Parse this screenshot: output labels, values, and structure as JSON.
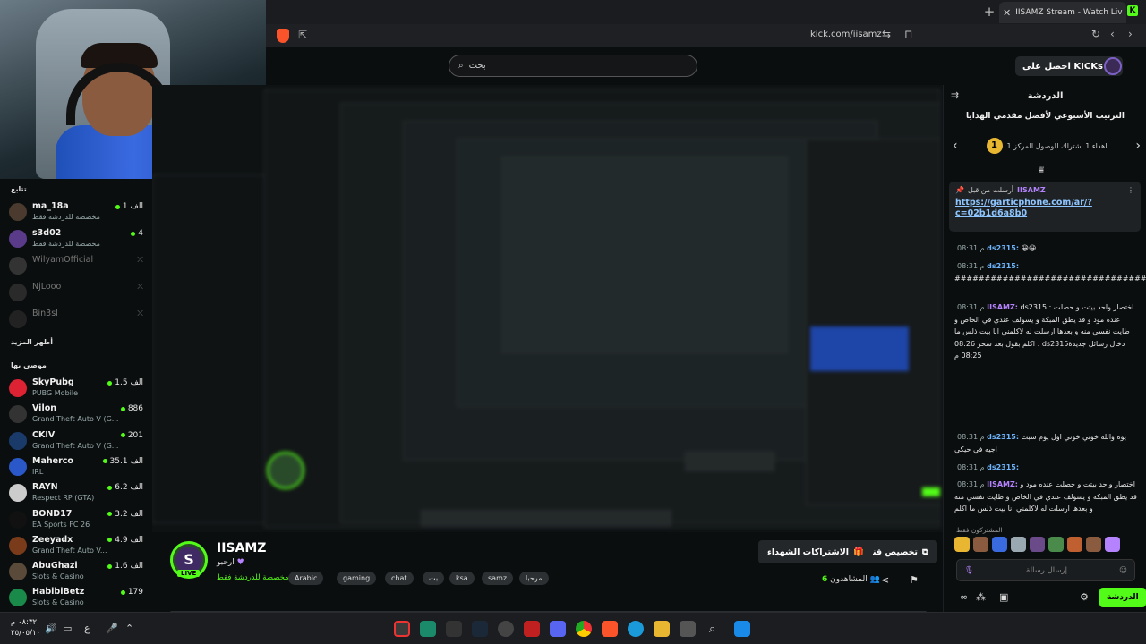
{
  "browser": {
    "tab_title": "IISAMZ Stream - Watch Live on K",
    "url": "kick.com/iisamz"
  },
  "header": {
    "search_placeholder": "بحث",
    "get_kicks": "احصل على KICKs"
  },
  "sidebar": {
    "following_label": "تتابع",
    "show_more": "أظهر المزيد",
    "recommended_label": "موصى بها",
    "following": [
      {
        "name": "ma_18a",
        "sub": "مخصصة للدردشة فقط",
        "count": "1 الف",
        "live": true,
        "color": "#4a3b2e"
      },
      {
        "name": "s3d02",
        "sub": "مخصصة للدردشة فقط",
        "count": "4",
        "live": true,
        "color": "#5a3b8a"
      },
      {
        "name": "WilyamOfficial",
        "sub": "",
        "count": "",
        "live": false,
        "color": "#333"
      },
      {
        "name": "NjLooo",
        "sub": "",
        "count": "",
        "live": false,
        "color": "#2a2a2a"
      },
      {
        "name": "Bin3sl",
        "sub": "",
        "count": "",
        "live": false,
        "color": "#222"
      }
    ],
    "recommended": [
      {
        "name": "SkyPubg",
        "sub": "PUBG Mobile",
        "count": "1.5 الف",
        "color": "#d23"
      },
      {
        "name": "Vilon",
        "sub": "Grand Theft Auto V (G...",
        "count": "886",
        "color": "#333"
      },
      {
        "name": "CKIV",
        "sub": "Grand Theft Auto V (G...",
        "count": "201",
        "color": "#1a3b6a"
      },
      {
        "name": "Maherco",
        "sub": "IRL",
        "count": "35.1 الف",
        "color": "#2a58c8"
      },
      {
        "name": "RAYN",
        "sub": "Respect RP (GTA)",
        "count": "6.2 الف",
        "color": "#ccc"
      },
      {
        "name": "BOND17",
        "sub": "EA Sports FC 26",
        "count": "3.2 الف",
        "color": "#111"
      },
      {
        "name": "Zeeyadx",
        "sub": "Grand Theft Auto V...",
        "count": "4.9 الف",
        "color": "#7a3b1a"
      },
      {
        "name": "AbuGhazi",
        "sub": "Slots & Casino",
        "count": "1.6 الف",
        "color": "#5a4a3a"
      },
      {
        "name": "HabibiBetz",
        "sub": "Slots & Casino",
        "count": "179",
        "color": "#1a8a4a"
      }
    ]
  },
  "stream": {
    "channel_name": "IISAMZ",
    "title": "ارحبو",
    "category": "مخصصة للدردشة فقط",
    "live_badge": "LIVE",
    "avatar_letter": "S",
    "tags": [
      "Arabic",
      "gaming",
      "chat",
      "بث",
      "ksa",
      "samz",
      "مرحبا"
    ],
    "customize_btn": "تخصيص قناتك",
    "subs_btn": "الاشتراكات الشهداء",
    "viewers_label": "المشاهدون",
    "viewers_count": "6"
  },
  "chat": {
    "header": "الدردشة",
    "leaderboard_title": "الترتيب الأسبوعي لأفضل مقدمي الهدايا",
    "leaderboard_rank": "1",
    "leaderboard_text": "اهداء 1 اشتراك للوصول المركز 1",
    "pinned_by": "أرسلت من قبل",
    "pinned_user": "IISAMZ",
    "pinned_link": "https://garticphone.com/ar/?c=02b1d6a8b0",
    "messages": [
      {
        "time": "08:31 م",
        "user": "ds2315:",
        "text": "😀😀",
        "ucls": "u1"
      },
      {
        "time": "08:31 م",
        "user": "ds2315:",
        "text": "################################",
        "ucls": "u1"
      },
      {
        "time": "08:31 م",
        "user": "IISAMZ:",
        "text": "ds2315 : اختصار واحد بيتت و حصلت عنده مود و قد يطق المبكة و يسولف عندي في الخاص و طايت نفسي منه و بعدها ارسلت له لاكلمني انا بيت ذلس ما اكلم بقول بعد سحر 08:26 : ds2315دخال رسائل جديدة 08:25 م",
        "ucls": "u2"
      },
      {
        "time": "08:31 م",
        "user": "ds2315:",
        "text": "يوه والله خوتي خوتي اول يوم سبت اجيه في حيكي",
        "ucls": "u1"
      },
      {
        "time": "08:31 م",
        "user": "ds2315:",
        "text": "",
        "ucls": "u1"
      },
      {
        "time": "08:31 م",
        "user": "IISAMZ:",
        "text": "اختصار واحد بيتت و حصلت عنده مود و قد يطق المبكة و يسولف عندي في الخاص و طايت نفسي منه و بعدها ارسلت له لاكلمني انا بيت ذلس ما اكلم",
        "ucls": "u2"
      }
    ],
    "subs_only": "المشتركون فقط",
    "input_placeholder": "إرسال رسالة",
    "send_button": "الدردشة"
  },
  "taskbar": {
    "time": "٠٨:٣٢ م",
    "date": "٢٥/٠٥/١٠"
  }
}
